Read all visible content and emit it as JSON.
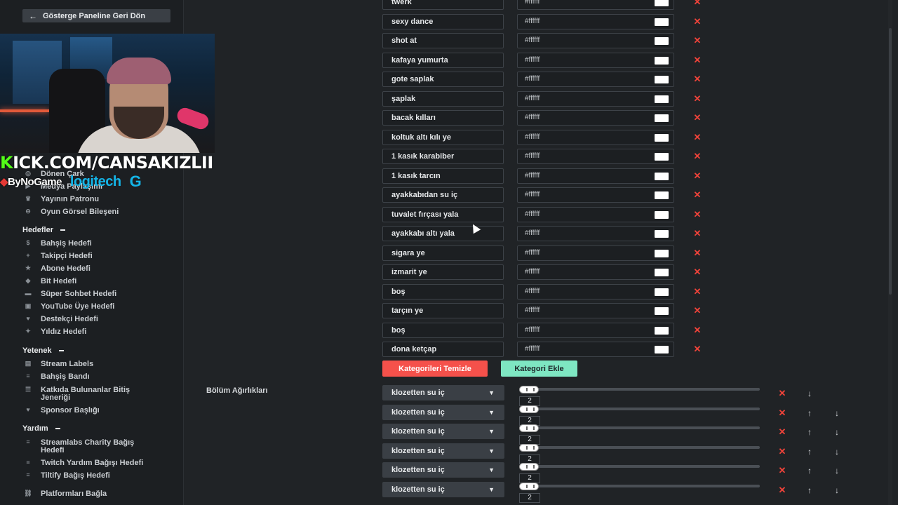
{
  "sidebar": {
    "back_label": "Gösterge Paneline Geri Dön",
    "items_top": [
      {
        "label": "Dönen Çark",
        "icon": "wheel-icon"
      },
      {
        "label": "Medya Paylaşımı",
        "icon": "media-icon"
      },
      {
        "label": "Yayının Patronu",
        "icon": "crown-icon"
      },
      {
        "label": "Oyun Görsel Bileşeni",
        "icon": "gamepad-icon"
      }
    ],
    "section_goals": "Hedefler",
    "goals": [
      {
        "label": "Bahşiş Hedefi",
        "icon": "tip-icon"
      },
      {
        "label": "Takipçi Hedefi",
        "icon": "follower-icon"
      },
      {
        "label": "Abone Hedefi",
        "icon": "subscriber-icon"
      },
      {
        "label": "Bit Hedefi",
        "icon": "bits-icon"
      },
      {
        "label": "Süper Sohbet Hedefi",
        "icon": "superchat-icon"
      },
      {
        "label": "YouTube Üye Hedefi",
        "icon": "youtube-icon"
      },
      {
        "label": "Destekçi Hedefi",
        "icon": "supporter-icon"
      },
      {
        "label": "Yıldız Hedefi",
        "icon": "star-icon"
      }
    ],
    "section_skills": "Yetenek",
    "skills": [
      {
        "label": "Stream Labels",
        "icon": "labels-icon"
      },
      {
        "label": "Bahşiş Bandı",
        "icon": "ticker-icon"
      },
      {
        "label": "Katkıda Bulunanlar Bitiş Jeneriği",
        "icon": "credits-icon"
      },
      {
        "label": "Sponsor Başlığı",
        "icon": "heart-icon"
      }
    ],
    "section_help": "Yardım",
    "help": [
      {
        "label": "Streamlabs Charity Bağış Hedefi",
        "icon": "charity-icon"
      },
      {
        "label": "Twitch Yardım Bağışı Hedefi",
        "icon": "charity-icon"
      },
      {
        "label": "Tiltify Bağış Hedefi",
        "icon": "charity-icon"
      }
    ],
    "platforms_label": "Platformları Bağla"
  },
  "overlay": {
    "kick_k": "K",
    "kick_rest": "ICK.COM/CANSAKIZLII",
    "bynogame": "ByNoGame",
    "logitech": "logitech",
    "logitech_g": "G"
  },
  "categories": [
    {
      "name": "twerk",
      "color": "#ffffff"
    },
    {
      "name": "sexy dance",
      "color": "#ffffff"
    },
    {
      "name": "shot at",
      "color": "#ffffff"
    },
    {
      "name": "kafaya yumurta",
      "color": "#ffffff"
    },
    {
      "name": "gote saplak",
      "color": "#ffffff"
    },
    {
      "name": "şaplak",
      "color": "#ffffff"
    },
    {
      "name": "bacak kılları",
      "color": "#ffffff"
    },
    {
      "name": "koltuk altı kılı ye",
      "color": "#ffffff"
    },
    {
      "name": "1 kasık karabiber",
      "color": "#ffffff"
    },
    {
      "name": "1 kasık tarcın",
      "color": "#ffffff"
    },
    {
      "name": "ayakkabıdan su iç",
      "color": "#ffffff"
    },
    {
      "name": "tuvalet fırçası yala",
      "color": "#ffffff"
    },
    {
      "name": "ayakkabı altı yala",
      "color": "#ffffff"
    },
    {
      "name": "sigara ye",
      "color": "#ffffff"
    },
    {
      "name": "izmarit ye",
      "color": "#ffffff"
    },
    {
      "name": "boş",
      "color": "#ffffff"
    },
    {
      "name": "tarçın ye",
      "color": "#ffffff"
    },
    {
      "name": "boş",
      "color": "#ffffff"
    },
    {
      "name": "dona ketçap",
      "color": "#ffffff"
    }
  ],
  "buttons": {
    "clear": "Kategorileri Temizle",
    "add": "Kategori Ekle"
  },
  "weights_label": "Bölüm Ağırlıkları",
  "weights": [
    {
      "option": "klozetten su iç",
      "value": "2",
      "up": false,
      "down": true
    },
    {
      "option": "klozetten su iç",
      "value": "2",
      "up": true,
      "down": true
    },
    {
      "option": "klozetten su iç",
      "value": "2",
      "up": true,
      "down": true
    },
    {
      "option": "klozetten su iç",
      "value": "2",
      "up": true,
      "down": true
    },
    {
      "option": "klozetten su iç",
      "value": "2",
      "up": true,
      "down": true
    },
    {
      "option": "klozetten su iç",
      "value": "2",
      "up": true,
      "down": true
    }
  ],
  "colors": {
    "danger": "#f5514b",
    "accent": "#7ee6c2",
    "kick_green": "#53fc18"
  }
}
